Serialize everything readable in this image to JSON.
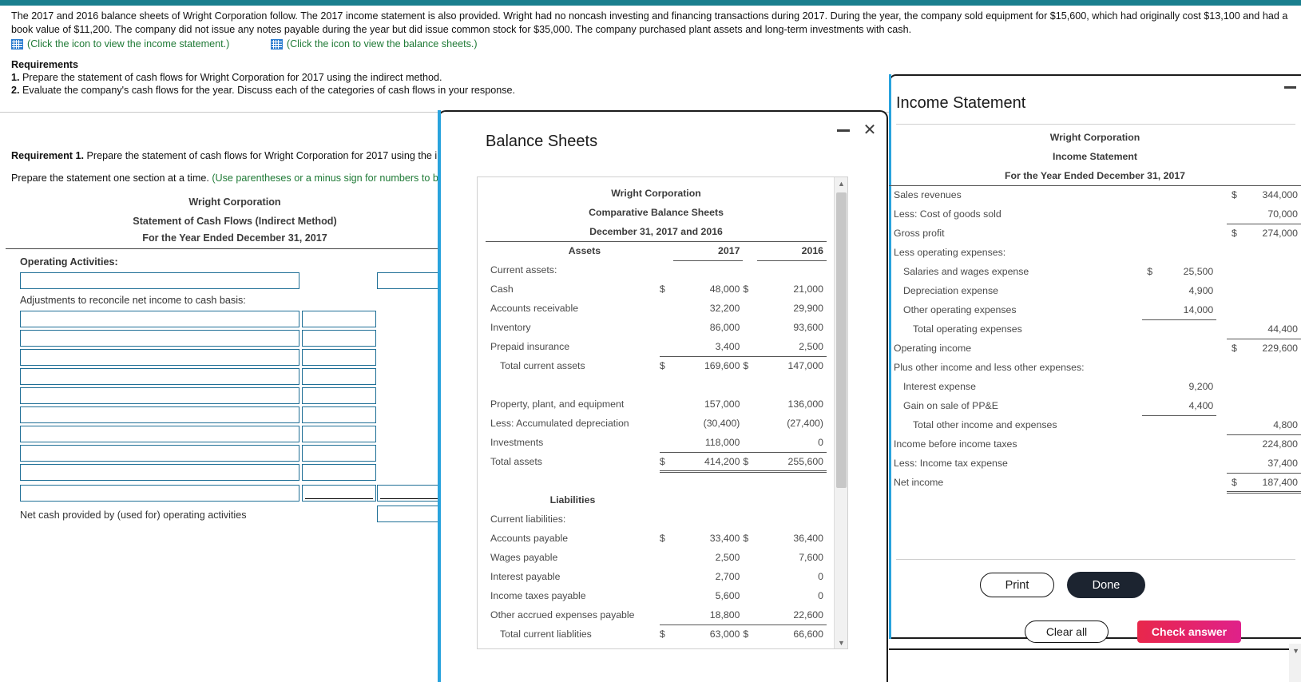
{
  "problem": {
    "paragraph": "The 2017 and 2016 balance sheets of Wright Corporation follow. The 2017 income statement is also provided. Wright had no noncash investing and financing transactions during 2017. During the year, the company sold equipment for $15,600, which had originally cost $13,100 and had a book value of $11,200. The company did not issue any notes payable during the year but did issue common stock for $35,000. The company purchased plant assets and long-term investments with cash.",
    "income_link": "(Click the icon to view the income statement.)",
    "balance_link": "(Click the icon to view the balance sheets.)",
    "requirements_heading": "Requirements",
    "req1_num": "1.",
    "req1_text": " Prepare the statement of cash flows for Wright Corporation for 2017 using the indirect method.",
    "req2_num": "2.",
    "req2_text": " Evaluate the company's cash flows for the year. Discuss each of the categories of cash flows in your response."
  },
  "work": {
    "req1_label": "Requirement 1.",
    "req1_body": " Prepare the statement of cash flows for Wright Corporation for 2017 using the i",
    "prep_black": "Prepare the statement one section at a time. ",
    "prep_green": "(Use parentheses or a minus sign for numbers to b",
    "title1": "Wright Corporation",
    "title2": "Statement of Cash Flows (Indirect Method)",
    "title3": "For the Year Ended December 31, 2017",
    "operating_label": "Operating Activities:",
    "adjust_label": "Adjustments to reconcile net income to cash basis:",
    "net_cash_label": "Net cash provided by (used for) operating activities",
    "rows": [
      {
        "desc": "",
        "amount": "",
        "total": ""
      },
      {
        "desc": "",
        "amount": "",
        "total": ""
      },
      {
        "desc": "",
        "amount": "",
        "total": ""
      },
      {
        "desc": "",
        "amount": "",
        "total": ""
      },
      {
        "desc": "",
        "amount": "",
        "total": ""
      },
      {
        "desc": "",
        "amount": "",
        "total": ""
      },
      {
        "desc": "",
        "amount": "",
        "total": ""
      },
      {
        "desc": "",
        "amount": "",
        "total": ""
      },
      {
        "desc": "",
        "amount": "",
        "total": ""
      },
      {
        "desc": "",
        "amount": "",
        "total": ""
      }
    ]
  },
  "income_statement": {
    "panel_title": "Income Statement",
    "company": "Wright Corporation",
    "statement": "Income Statement",
    "period": "For the Year Ended December 31, 2017",
    "rows": [
      {
        "label": "Sales revenues",
        "indent": 0,
        "c1_dol": "",
        "c1": "",
        "c2_dol": "$",
        "c2": "344,000",
        "rule": ""
      },
      {
        "label": "Less: Cost of goods sold",
        "indent": 0,
        "c1_dol": "",
        "c1": "",
        "c2_dol": "",
        "c2": "70,000",
        "rule": "c2-under"
      },
      {
        "label": "Gross profit",
        "indent": 0,
        "c1_dol": "",
        "c1": "",
        "c2_dol": "$",
        "c2": "274,000",
        "rule": ""
      },
      {
        "label": "Less operating expenses:",
        "indent": 0,
        "c1_dol": "",
        "c1": "",
        "c2_dol": "",
        "c2": "",
        "rule": ""
      },
      {
        "label": "Salaries and wages expense",
        "indent": 1,
        "c1_dol": "$",
        "c1": "25,500",
        "c2_dol": "",
        "c2": "",
        "rule": ""
      },
      {
        "label": "Depreciation expense",
        "indent": 1,
        "c1_dol": "",
        "c1": "4,900",
        "c2_dol": "",
        "c2": "",
        "rule": ""
      },
      {
        "label": "Other operating expenses",
        "indent": 1,
        "c1_dol": "",
        "c1": "14,000",
        "c2_dol": "",
        "c2": "",
        "rule": "c1-under"
      },
      {
        "label": "Total operating expenses",
        "indent": 2,
        "c1_dol": "",
        "c1": "",
        "c2_dol": "",
        "c2": "44,400",
        "rule": "c2-under"
      },
      {
        "label": "Operating income",
        "indent": 0,
        "c1_dol": "",
        "c1": "",
        "c2_dol": "$",
        "c2": "229,600",
        "rule": ""
      },
      {
        "label": "Plus other income and less other expenses:",
        "indent": 0,
        "c1_dol": "",
        "c1": "",
        "c2_dol": "",
        "c2": "",
        "rule": ""
      },
      {
        "label": "Interest expense",
        "indent": 1,
        "c1_dol": "",
        "c1": "9,200",
        "c2_dol": "",
        "c2": "",
        "rule": ""
      },
      {
        "label": "Gain on sale of PP&E",
        "indent": 1,
        "c1_dol": "",
        "c1": "4,400",
        "c2_dol": "",
        "c2": "",
        "rule": "c1-under"
      },
      {
        "label": "Total other income and expenses",
        "indent": 2,
        "c1_dol": "",
        "c1": "",
        "c2_dol": "",
        "c2": "4,800",
        "rule": "c2-under"
      },
      {
        "label": "Income before income taxes",
        "indent": 0,
        "c1_dol": "",
        "c1": "",
        "c2_dol": "",
        "c2": "224,800",
        "rule": ""
      },
      {
        "label": "Less: Income tax expense",
        "indent": 0,
        "c1_dol": "",
        "c1": "",
        "c2_dol": "",
        "c2": "37,400",
        "rule": "c2-under"
      },
      {
        "label": "Net income",
        "indent": 0,
        "c1_dol": "",
        "c1": "",
        "c2_dol": "$",
        "c2": "187,400",
        "rule": "c2-double"
      }
    ],
    "print_label": "Print",
    "done_label": "Done"
  },
  "balance_sheets": {
    "panel_title": "Balance Sheets",
    "company": "Wright Corporation",
    "statement": "Comparative Balance Sheets",
    "period": "December 31, 2017 and 2016",
    "col_assets": "Assets",
    "col_2017": "2017",
    "col_2016": "2016",
    "section_liabilities": "Liabilities",
    "rows": [
      {
        "label": "Current assets:",
        "indent": 0,
        "d17": "",
        "v17": "",
        "d16": "",
        "v16": "",
        "rule": ""
      },
      {
        "label": "Cash",
        "indent": 0,
        "d17": "$",
        "v17": "48,000",
        "d16": "$",
        "v16": "21,000",
        "rule": ""
      },
      {
        "label": "Accounts receivable",
        "indent": 0,
        "d17": "",
        "v17": "32,200",
        "d16": "",
        "v16": "29,900",
        "rule": ""
      },
      {
        "label": "Inventory",
        "indent": 0,
        "d17": "",
        "v17": "86,000",
        "d16": "",
        "v16": "93,600",
        "rule": ""
      },
      {
        "label": "Prepaid insurance",
        "indent": 0,
        "d17": "",
        "v17": "3,400",
        "d16": "",
        "v16": "2,500",
        "rule": "under"
      },
      {
        "label": "Total current assets",
        "indent": 1,
        "d17": "$",
        "v17": "169,600",
        "d16": "$",
        "v16": "147,000",
        "rule": ""
      },
      {
        "label": "",
        "indent": 0,
        "d17": "",
        "v17": "",
        "d16": "",
        "v16": "",
        "rule": ""
      },
      {
        "label": "Property, plant, and equipment",
        "indent": 0,
        "d17": "",
        "v17": "157,000",
        "d16": "",
        "v16": "136,000",
        "rule": ""
      },
      {
        "label": "Less: Accumulated depreciation",
        "indent": 0,
        "d17": "",
        "v17": "(30,400)",
        "d16": "",
        "v16": "(27,400)",
        "rule": ""
      },
      {
        "label": "Investments",
        "indent": 0,
        "d17": "",
        "v17": "118,000",
        "d16": "",
        "v16": "0",
        "rule": "under"
      },
      {
        "label": "Total assets",
        "indent": 0,
        "d17": "$",
        "v17": "414,200",
        "d16": "$",
        "v16": "255,600",
        "rule": "double"
      },
      {
        "label": "",
        "indent": 0,
        "d17": "",
        "v17": "",
        "d16": "",
        "v16": "",
        "rule": ""
      },
      {
        "label": "Current liabilities:",
        "indent": 0,
        "d17": "",
        "v17": "",
        "d16": "",
        "v16": "",
        "rule": ""
      },
      {
        "label": "Accounts payable",
        "indent": 0,
        "d17": "$",
        "v17": "33,400",
        "d16": "$",
        "v16": "36,400",
        "rule": ""
      },
      {
        "label": "Wages payable",
        "indent": 0,
        "d17": "",
        "v17": "2,500",
        "d16": "",
        "v16": "7,600",
        "rule": ""
      },
      {
        "label": "Interest payable",
        "indent": 0,
        "d17": "",
        "v17": "2,700",
        "d16": "",
        "v16": "0",
        "rule": ""
      },
      {
        "label": "Income taxes payable",
        "indent": 0,
        "d17": "",
        "v17": "5,600",
        "d16": "",
        "v16": "0",
        "rule": ""
      },
      {
        "label": "Other accrued expenses payable",
        "indent": 0,
        "d17": "",
        "v17": "18,800",
        "d16": "",
        "v16": "22,600",
        "rule": "under"
      },
      {
        "label": "Total current liablities",
        "indent": 1,
        "d17": "$",
        "v17": "63,000",
        "d16": "$",
        "v16": "66,600",
        "rule": ""
      }
    ]
  },
  "footer": {
    "clear_all": "Clear all",
    "check_answer": "Check answer"
  },
  "icons": {
    "grid": "grid-icon",
    "close": "✕",
    "minimize": "minimize-icon",
    "scroll_up": "▲",
    "scroll_down": "▼"
  }
}
